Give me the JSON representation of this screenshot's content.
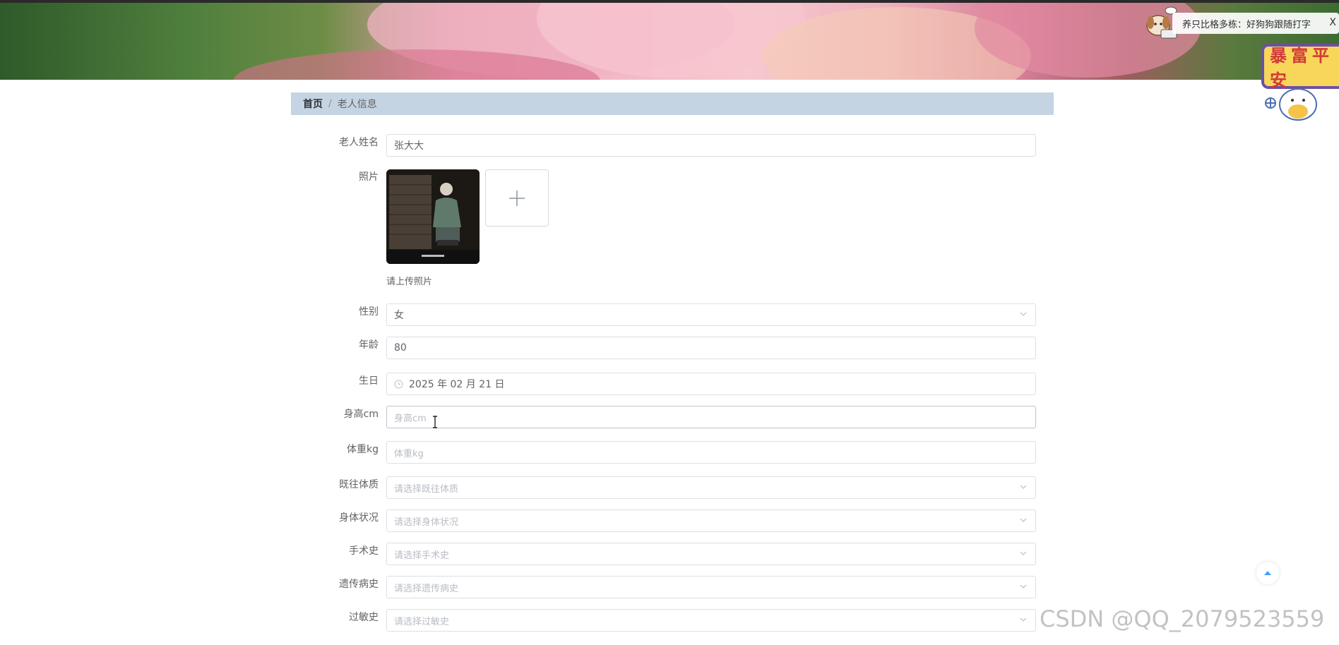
{
  "notice": {
    "text": "养只比格多栋：好狗狗跟随打字",
    "close": "X"
  },
  "badge": {
    "text": "暴富平安"
  },
  "breadcrumb": {
    "home": "首页",
    "separator": "/",
    "current": "老人信息"
  },
  "form": {
    "name": {
      "label": "老人姓名",
      "value": "张大大"
    },
    "photo": {
      "label": "照片",
      "hint": "请上传照片"
    },
    "gender": {
      "label": "性别",
      "value": "女"
    },
    "age": {
      "label": "年龄",
      "value": "80"
    },
    "birthday": {
      "label": "生日",
      "value": "2025 年 02 月 21 日"
    },
    "height": {
      "label": "身高cm",
      "placeholder": "身高cm"
    },
    "weight": {
      "label": "体重kg",
      "placeholder": "体重kg"
    },
    "constitution": {
      "label": "既往体质",
      "placeholder": "请选择既往体质"
    },
    "condition": {
      "label": "身体状况",
      "placeholder": "请选择身体状况"
    },
    "surgery": {
      "label": "手术史",
      "placeholder": "请选择手术史"
    },
    "genetic": {
      "label": "遗传病史",
      "placeholder": "请选择遗传病史"
    },
    "allergy": {
      "label": "过敏史",
      "placeholder": "请选择过敏史"
    }
  },
  "watermark": "CSDN @QQ_2079523559",
  "colors": {
    "breadcrumb_bg": "#c5d4e3",
    "border": "#dcdfe6",
    "label": "#606266",
    "placeholder": "#b8bcc4"
  }
}
